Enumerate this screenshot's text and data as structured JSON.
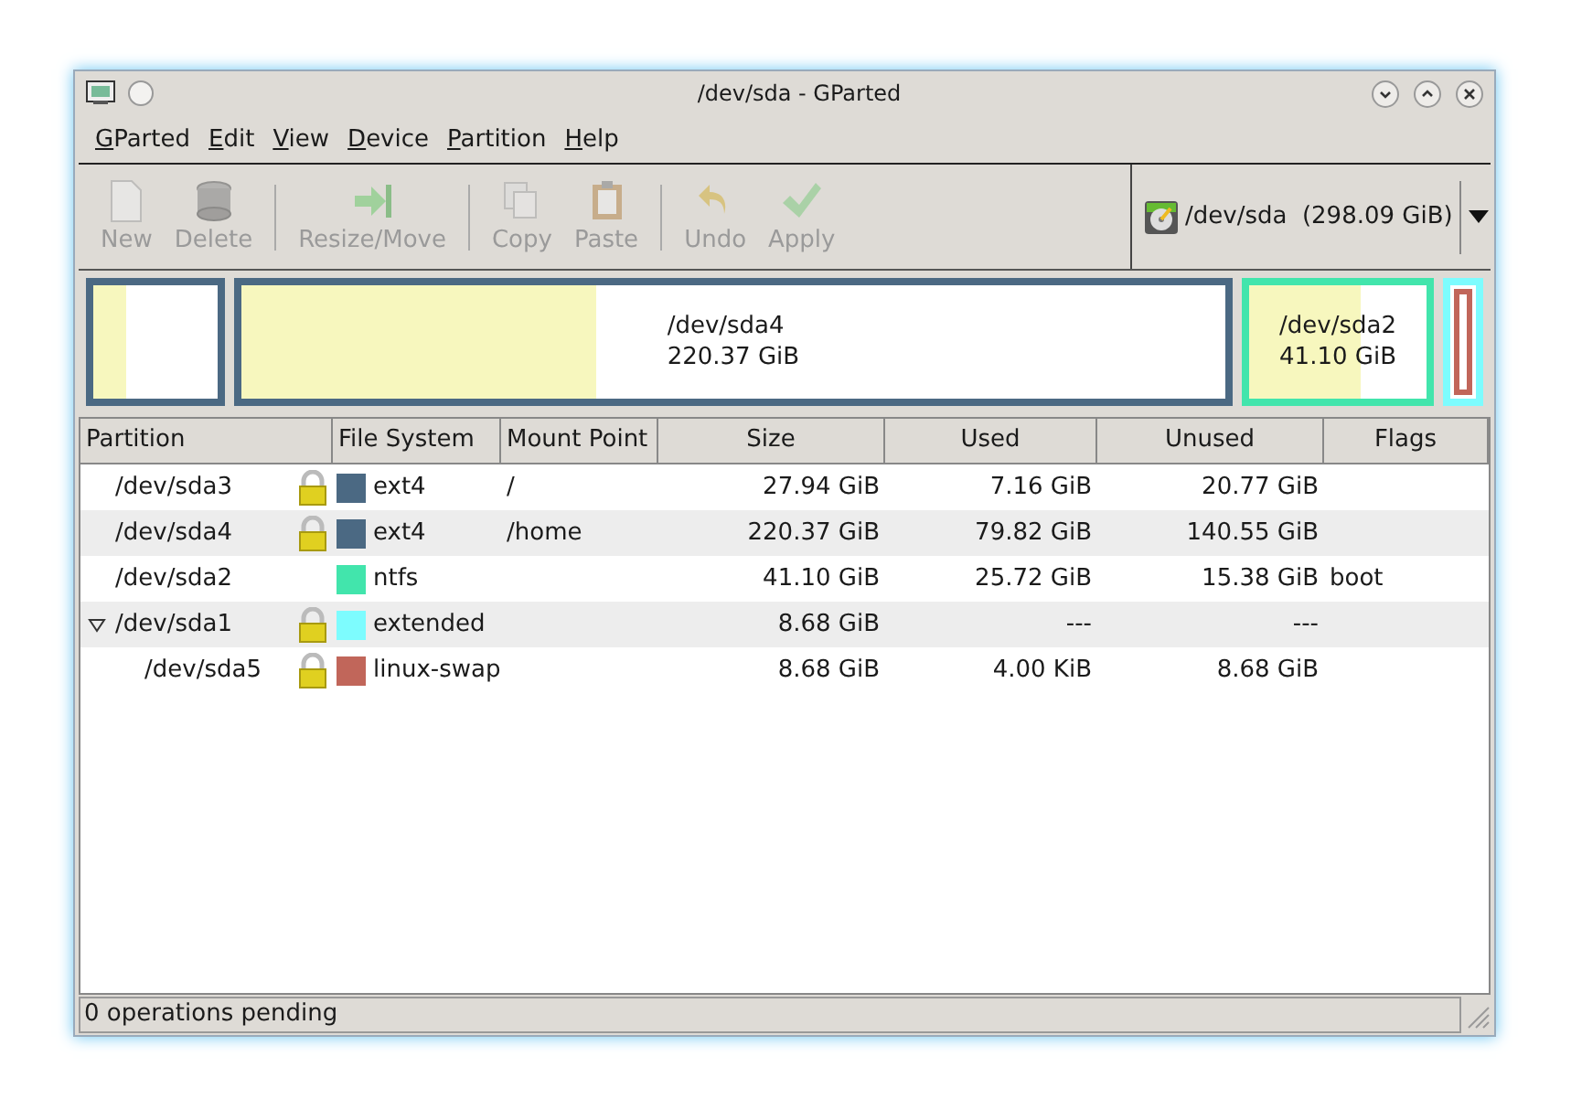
{
  "window": {
    "title": "/dev/sda - GParted"
  },
  "menu": [
    "GParted",
    "Edit",
    "View",
    "Device",
    "Partition",
    "Help"
  ],
  "toolbar": [
    {
      "kind": "new",
      "label": "New",
      "disabled": true
    },
    {
      "kind": "delete",
      "label": "Delete",
      "disabled": true
    },
    {
      "kind": "separator"
    },
    {
      "kind": "resize",
      "label": "Resize/Move",
      "disabled": true
    },
    {
      "kind": "separator"
    },
    {
      "kind": "copy",
      "label": "Copy",
      "disabled": true
    },
    {
      "kind": "paste",
      "label": "Paste",
      "disabled": true
    },
    {
      "kind": "separator"
    },
    {
      "kind": "undo",
      "label": "Undo",
      "disabled": true
    },
    {
      "kind": "apply",
      "label": "Apply",
      "disabled": true
    }
  ],
  "device": {
    "label": "/dev/sda  (298.09 GiB)"
  },
  "disk_map": [
    {
      "color": "#4b6983",
      "level": 0.26
    },
    {
      "color": "#4b6983",
      "level": 0.36,
      "name": "/dev/sda4",
      "size": "220.37 GiB"
    },
    {
      "color": "#42e5ac",
      "level": 0.63,
      "name": "/dev/sda2",
      "size": "41.10 GiB"
    },
    {
      "color": "#7dfcfe",
      "children": [
        {
          "color": "#c1665a"
        }
      ]
    }
  ],
  "table": {
    "columns": [
      "Partition",
      "File System",
      "Mount Point",
      "Size",
      "Used",
      "Unused",
      "Flags"
    ],
    "rows": [
      {
        "partition": "/dev/sda3",
        "locked": true,
        "color": "#4b6983",
        "fs": "ext4",
        "mount": "/",
        "size": "27.94 GiB",
        "used": "7.16 GiB",
        "unused": "20.77 GiB"
      },
      {
        "partition": "/dev/sda4",
        "locked": true,
        "color": "#4b6983",
        "fs": "ext4",
        "mount": "/home",
        "size": "220.37 GiB",
        "used": "79.82 GiB",
        "unused": "140.55 GiB"
      },
      {
        "partition": "/dev/sda2",
        "locked": false,
        "color": "#42e5ac",
        "fs": "ntfs",
        "size": "41.10 GiB",
        "used": "25.72 GiB",
        "unused": "15.38 GiB",
        "flags": "boot"
      },
      {
        "partition": "/dev/sda1",
        "locked": true,
        "color": "#7dfcfe",
        "fs": "extended",
        "size": "8.68 GiB",
        "used": "---",
        "unused": "---",
        "expanded": true,
        "children": [
          {
            "partition": "/dev/sda5",
            "locked": true,
            "color": "#c1665a",
            "fs": "linux-swap",
            "size": "8.68 GiB",
            "used": "4.00 KiB",
            "unused": "8.68 GiB"
          }
        ]
      }
    ]
  },
  "status_bar": "0 operations pending"
}
